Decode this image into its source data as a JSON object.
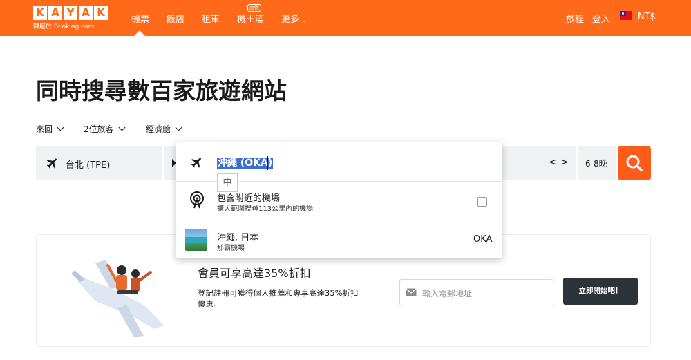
{
  "brand": {
    "letters": [
      "K",
      "A",
      "Y",
      "A",
      "K"
    ],
    "subtitle": "隸屬於 Booking.com"
  },
  "nav": {
    "items": [
      {
        "label": "機票",
        "active": true
      },
      {
        "label": "飯店"
      },
      {
        "label": "租車"
      },
      {
        "label": "機＋酒",
        "badge": "度假"
      },
      {
        "label": "更多"
      }
    ],
    "trips": "旅程",
    "login": "登入",
    "currency": "NT$"
  },
  "page_title": "同時搜尋數百家旅遊網站",
  "search_options": {
    "trip_type": "來回",
    "travelers": "2位旅客",
    "cabin": "經濟艙"
  },
  "search_bar": {
    "origin": "台北 (TPE)",
    "date_prev": "<",
    "date_next": ">",
    "nights": "6-8晚"
  },
  "dropdown": {
    "query": "沖繩 (OKA)",
    "nearby_title": "包含附近的機場",
    "nearby_subtitle": "擴大範圍搜尋113公里內的機場",
    "result_title": "沖繩, 日本",
    "result_subtitle": "那霸機場",
    "result_code": "OKA"
  },
  "ime": {
    "label": "中"
  },
  "promo": {
    "title": "會員可享高達35%折扣",
    "description": "登記註冊可獲得個人推薦和專享高達35%折扣優惠。",
    "email_placeholder": "輸入電郵地址",
    "cta": "立即開始吧！"
  },
  "colors": {
    "brand_orange": "#ff6a1a",
    "search_button": "#ff5b1a",
    "cta_dark": "#2c3339",
    "selection_blue": "#3b6fd6"
  },
  "icons": [
    "plane-icon",
    "search-icon",
    "nearby-airport-icon",
    "mail-icon",
    "chevron-down-icon",
    "taiwan-flag-icon"
  ]
}
